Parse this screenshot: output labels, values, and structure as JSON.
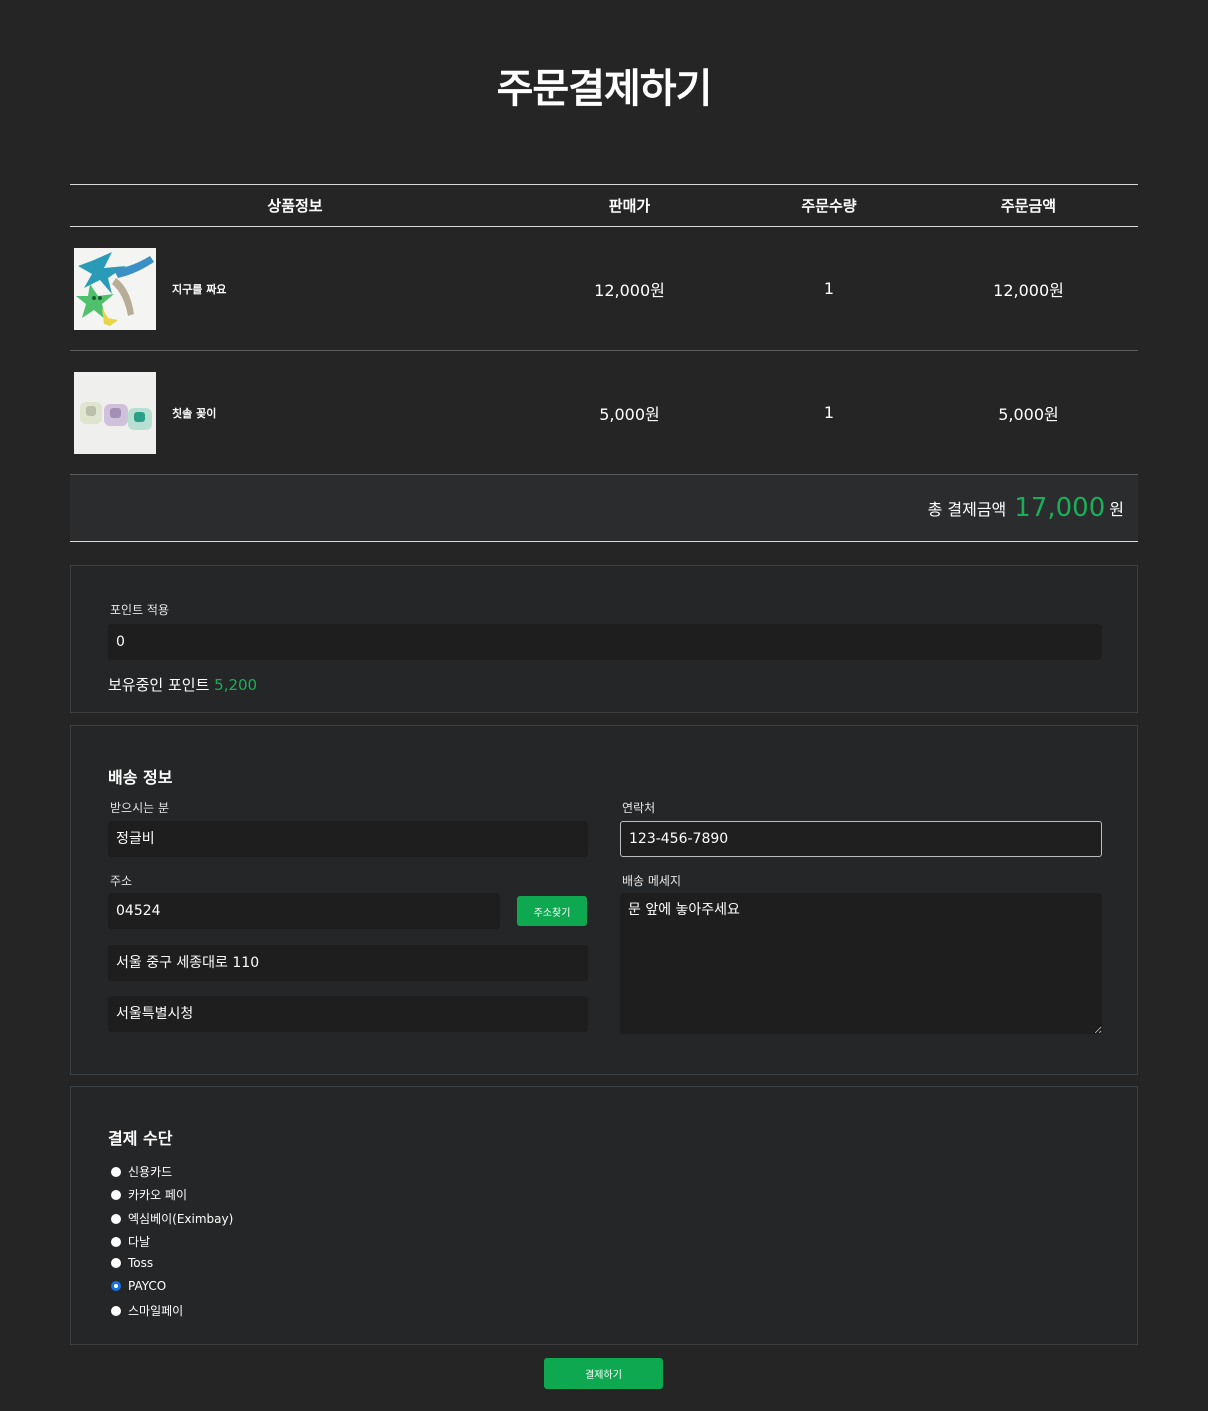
{
  "page_title": "주문결제하기",
  "table": {
    "headers": [
      "상품정보",
      "판매가",
      "주문수량",
      "주문금액"
    ],
    "rows": [
      {
        "name": "지구를 짜요",
        "price": "12,000원",
        "qty": "1",
        "amount": "12,000원"
      },
      {
        "name": "칫솔 꽂이",
        "price": "5,000원",
        "qty": "1",
        "amount": "5,000원"
      }
    ],
    "total_label": "총 결제금액",
    "total_amount": "17,000",
    "total_unit": "원"
  },
  "points": {
    "label": "포인트 적용",
    "value": "0",
    "owned_label": "보유중인 포인트",
    "owned_value": "5,200"
  },
  "shipping": {
    "title": "배송 정보",
    "recipient_label": "받으시는 분",
    "recipient_value": "정글비",
    "phone_label": "연락처",
    "phone_value": "123-456-7890",
    "address_label": "주소",
    "zipcode": "04524",
    "find_address_button": "주소찾기",
    "address1": "서울 중구 세종대로 110",
    "address2": "서울특별시청",
    "message_label": "배송 메세지",
    "message_value": "문 앞에 놓아주세요"
  },
  "payment": {
    "title": "결제 수단",
    "options": [
      "신용카드",
      "카카오 페이",
      "엑심베이(Eximbay)",
      "다날",
      "Toss",
      "PAYCO",
      "스마일페이"
    ],
    "selected": "PAYCO"
  },
  "submit_button": "결제하기",
  "colors": {
    "background": "#252525",
    "accent_green": "#1aae57",
    "button_green": "#0ea851",
    "radio_selected": "#1672e6"
  }
}
